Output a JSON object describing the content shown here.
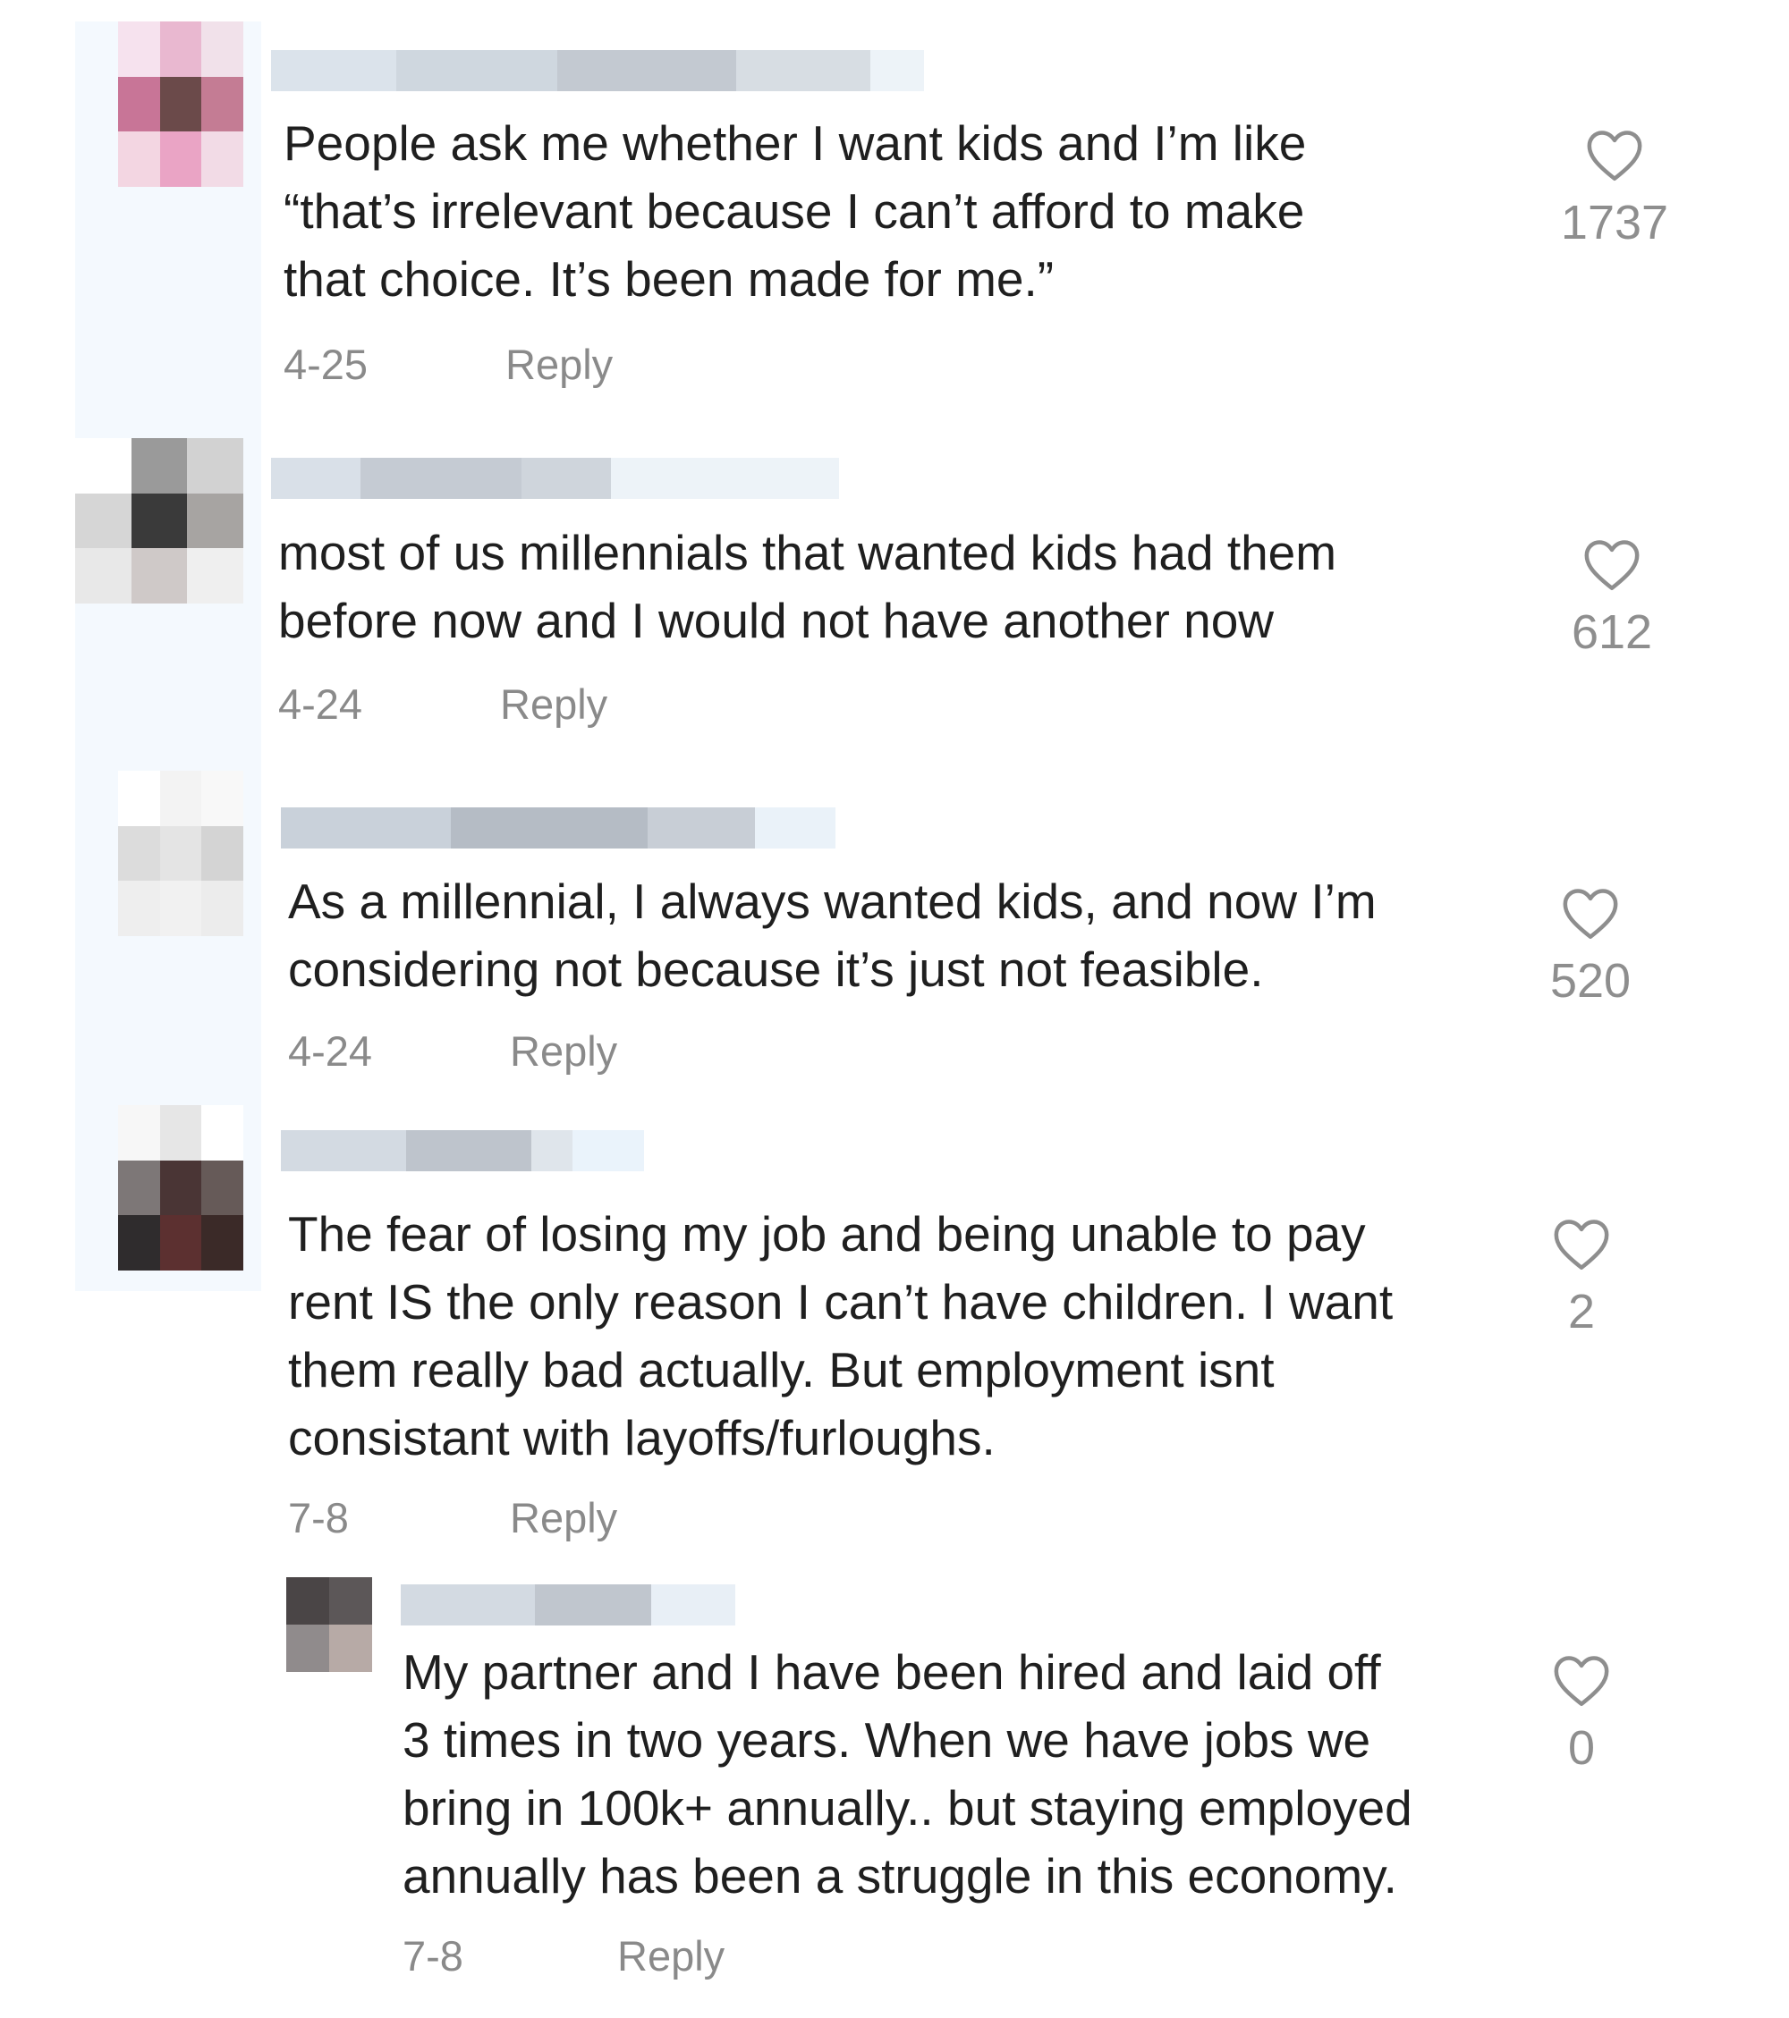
{
  "like_icon": "heart-outline-icon",
  "colors": {
    "text": "#1f1f1f",
    "meta": "#8a8a8a",
    "like_count": "#8e8e8e"
  },
  "comments": [
    {
      "text": "People ask me whether I want kids and I’m like\n“that’s irrelevant because I can’t afford to make\nthat choice. It’s been made for me.”",
      "date": "4-25",
      "reply": "Reply",
      "likes": "1737"
    },
    {
      "text": "most of us millennials that wanted kids had them\nbefore now and I would not have another now",
      "date": "4-24",
      "reply": "Reply",
      "likes": "612"
    },
    {
      "text": "As a millennial, I always wanted kids, and now I’m\nconsidering not because it’s just not feasible.",
      "date": "4-24",
      "reply": "Reply",
      "likes": "520"
    },
    {
      "text": "The fear of losing my job and being unable to pay\nrent IS the only reason I can’t have children. I want\nthem really bad actually. But employment isnt\nconsistant with layoffs/furloughs.",
      "date": "7-8",
      "reply": "Reply",
      "likes": "2"
    },
    {
      "text": "My partner and I have been hired and laid off\n3 times in two years. When we have jobs we\nbring in 100k+ annually.. but staying employed\nannually has been a struggle in this economy.",
      "date": "7-8",
      "reply": "Reply",
      "likes": "0"
    }
  ]
}
